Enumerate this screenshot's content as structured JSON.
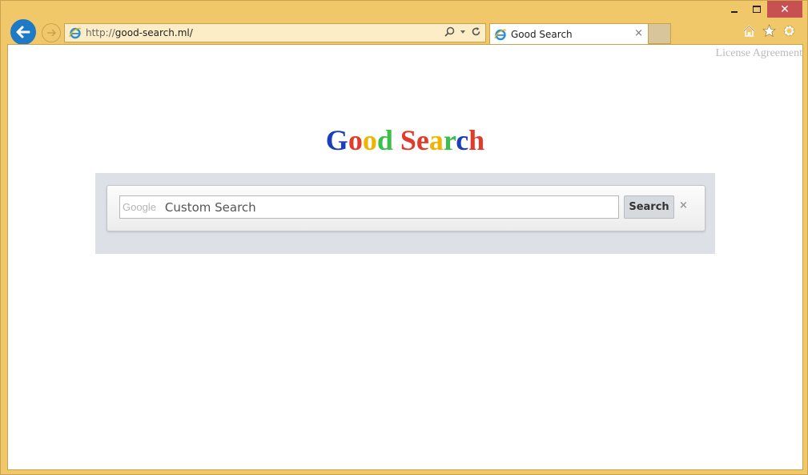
{
  "window": {
    "minimize_icon": "minimize-icon",
    "maximize_icon": "maximize-icon",
    "close_icon": "close-icon",
    "close_glyph": "✕"
  },
  "navigation": {
    "back_icon": "back-arrow-icon",
    "forward_icon": "forward-arrow-icon"
  },
  "address_bar": {
    "url_scheme": "http://",
    "url_host": "good-search.ml/",
    "search_icon": "search-icon",
    "dropdown_icon": "chevron-down-icon",
    "refresh_icon": "refresh-icon"
  },
  "tab": {
    "title": "Good Search",
    "close_glyph": "×"
  },
  "toolbar": {
    "home_icon": "home-icon",
    "favorites_icon": "star-icon",
    "settings_icon": "gear-icon"
  },
  "page": {
    "license_link": "License Agreement",
    "logo_letters": [
      {
        "char": "G",
        "color": "#1a3fbd"
      },
      {
        "char": "o",
        "color": "#e03c2c"
      },
      {
        "char": "o",
        "color": "#f0b400"
      },
      {
        "char": "d",
        "color": "#3cbf4a"
      },
      {
        "char": " ",
        "color": "#000000"
      },
      {
        "char": "S",
        "color": "#e03c2c"
      },
      {
        "char": "e",
        "color": "#e03c2c"
      },
      {
        "char": "a",
        "color": "#f0b400"
      },
      {
        "char": "r",
        "color": "#3cbf4a"
      },
      {
        "char": "c",
        "color": "#1a3fbd"
      },
      {
        "char": "h",
        "color": "#e03c2c"
      }
    ],
    "search": {
      "brand_mark": "Google",
      "placeholder": "Custom Search",
      "value": "",
      "button_label": "Search",
      "clear_glyph": "×"
    }
  }
}
